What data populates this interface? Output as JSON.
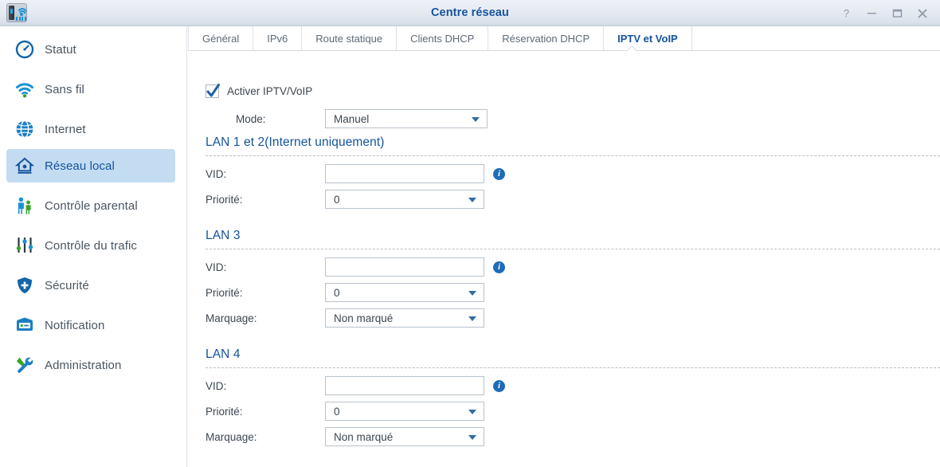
{
  "window": {
    "title": "Centre réseau",
    "app_icon": "router-wifi-icon",
    "controls": [
      {
        "name": "help-button",
        "glyph": "?"
      },
      {
        "name": "minimize-button",
        "glyph": "–"
      },
      {
        "name": "maximize-button",
        "glyph": "□"
      },
      {
        "name": "close-button",
        "glyph": "✕"
      }
    ]
  },
  "sidebar": {
    "items": [
      {
        "label": "Statut",
        "icon": "gauge-icon",
        "selected": false
      },
      {
        "label": "Sans fil",
        "icon": "wifi-icon",
        "selected": false
      },
      {
        "label": "Internet",
        "icon": "globe-icon",
        "selected": false
      },
      {
        "label": "Réseau local",
        "icon": "home-network-icon",
        "selected": true
      },
      {
        "label": "Contrôle parental",
        "icon": "parental-icon",
        "selected": false
      },
      {
        "label": "Contrôle du trafic",
        "icon": "sliders-icon",
        "selected": false
      },
      {
        "label": "Sécurité",
        "icon": "shield-icon",
        "selected": false
      },
      {
        "label": "Notification",
        "icon": "envelope-icon",
        "selected": false
      },
      {
        "label": "Administration",
        "icon": "tools-icon",
        "selected": false
      }
    ]
  },
  "tabs": [
    {
      "label": "Général",
      "active": false
    },
    {
      "label": "IPv6",
      "active": false
    },
    {
      "label": "Route statique",
      "active": false
    },
    {
      "label": "Clients DHCP",
      "active": false
    },
    {
      "label": "Réservation DHCP",
      "active": false
    },
    {
      "label": "IPTV et VoIP",
      "active": true
    }
  ],
  "form": {
    "enable_checkbox": {
      "label": "Activer IPTV/VoIP",
      "checked": true
    },
    "mode": {
      "label": "Mode:",
      "value": "Manuel"
    },
    "sections": [
      {
        "title": "LAN 1 et 2(Internet uniquement)",
        "vid": {
          "label": "VID:",
          "value": "",
          "placeholder": ""
        },
        "priority": {
          "label": "Priorité:",
          "value": "0"
        },
        "marking": null,
        "info": "info-icon"
      },
      {
        "title": "LAN 3",
        "vid": {
          "label": "VID:",
          "value": "",
          "placeholder": ""
        },
        "priority": {
          "label": "Priorité:",
          "value": "0"
        },
        "marking": {
          "label": "Marquage:",
          "value": "Non marqué"
        },
        "info": "info-icon"
      },
      {
        "title": "LAN 4",
        "vid": {
          "label": "VID:",
          "value": "",
          "placeholder": ""
        },
        "priority": {
          "label": "Priorité:",
          "value": "0"
        },
        "marking": {
          "label": "Marquage:",
          "value": "Non marqué"
        },
        "info": "info-icon"
      }
    ]
  },
  "colors": {
    "accent_blue": "#14539c",
    "selected_nav_bg": "#c3dcf2",
    "titlebar_top": "#eef1f6",
    "titlebar_bottom": "#d2dae6",
    "info_blue": "#1f6cb8",
    "label_text": "#3c4652"
  }
}
